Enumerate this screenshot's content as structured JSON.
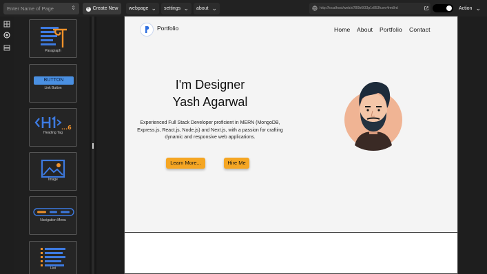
{
  "toolbar": {
    "page_search_placeholder": "Enter Name of Page",
    "create_label": "Create New",
    "webpage_label": "webpage",
    "settings_label": "settings",
    "about_label": "about",
    "url": "http://localhost/web/d780b6f33p1r853fuwv4rm8rd",
    "action_label": "Action"
  },
  "components": {
    "paragraph": "Paragraph",
    "link_button": "Link Button",
    "button_text": "BUTTON",
    "heading_tag": "Heading Tag",
    "image": "Image",
    "navigation_menu": "Navigation Menu",
    "list": "List"
  },
  "preview": {
    "brand": "Portfolio",
    "nav": [
      "Home",
      "About",
      "Portfolio",
      "Contact"
    ],
    "title_line1": "I'm Designer",
    "title_line2": "Yash Agarwal",
    "description": "Experienced Full Stack Developer proficient in MERN (MongoDB, Express.js, React.js, Node.js) and Next.js, with a passion for crafting dynamic and responsive web applications.",
    "learn_more": "Learn More...",
    "hire_me": "Hire Me"
  },
  "colors": {
    "accent_orange": "#f5a623",
    "blue": "#2f6fe0"
  }
}
